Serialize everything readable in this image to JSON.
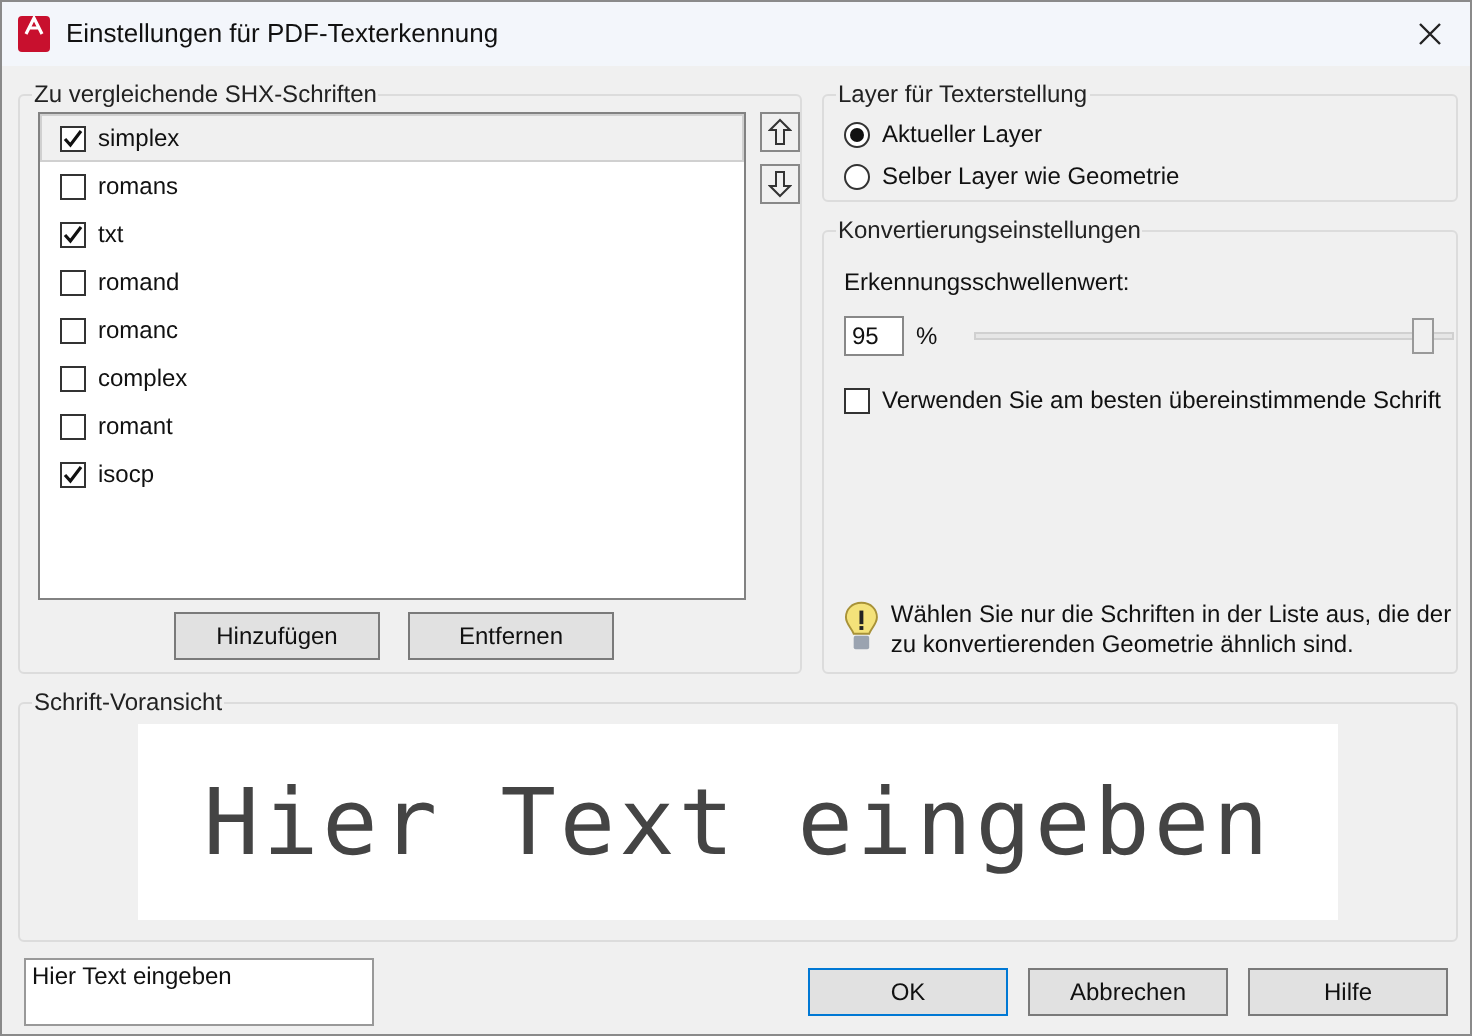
{
  "window": {
    "title": "Einstellungen für PDF-Texterkennung"
  },
  "fonts_group": {
    "title": "Zu vergleichende SHX-Schriften",
    "items": [
      {
        "label": "simplex",
        "checked": true,
        "selected": true
      },
      {
        "label": "romans",
        "checked": false,
        "selected": false
      },
      {
        "label": "txt",
        "checked": true,
        "selected": false
      },
      {
        "label": "romand",
        "checked": false,
        "selected": false
      },
      {
        "label": "romanc",
        "checked": false,
        "selected": false
      },
      {
        "label": "complex",
        "checked": false,
        "selected": false
      },
      {
        "label": "romant",
        "checked": false,
        "selected": false
      },
      {
        "label": "isocp",
        "checked": true,
        "selected": false
      }
    ],
    "buttons": [
      "Hinzufügen",
      "Entfernen"
    ]
  },
  "layer_group": {
    "title": "Layer für Texterstellung",
    "options": [
      {
        "label": "Aktueller Layer",
        "selected": true
      },
      {
        "label": "Selber Layer wie Geometrie",
        "selected": false
      }
    ]
  },
  "conversion_group": {
    "title": "Konvertierungseinstellungen",
    "threshold_label": "Erkennungsschwellenwert:",
    "threshold_value": "95",
    "unit": "%",
    "level": 0.94,
    "best_match": {
      "label": "Verwenden Sie am besten übereinstimmende Schrift",
      "checked": false
    },
    "hint": "Wählen Sie nur die Schriften in der Liste aus, die der zu konvertierenden Geometrie ähnlich sind."
  },
  "preview_group": {
    "title": "Schrift-Voransicht",
    "preview_text": "Hier Text eingeben"
  },
  "sample_text": {
    "value": "Hier Text eingeben"
  },
  "buttons": [
    {
      "label": "OK",
      "default": true
    },
    {
      "label": "Abbrechen",
      "default": false
    },
    {
      "label": "Hilfe",
      "default": false
    }
  ]
}
